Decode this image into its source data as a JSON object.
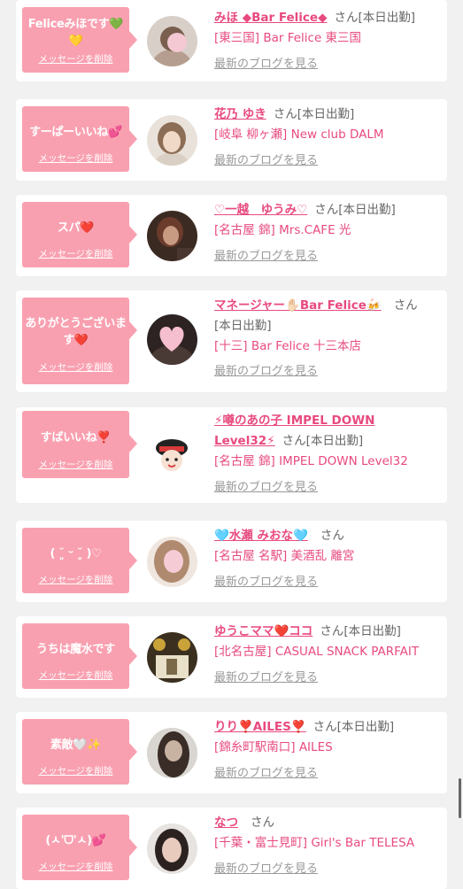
{
  "cards": [
    {
      "message": "Feliceみほです💚💛",
      "delete_label": "メッセージを削除",
      "name": "みほ ◆Bar Felice◆",
      "san": "さん",
      "shift": "[本日出勤]",
      "shop": "[東三国] Bar Felice 東三国",
      "blog": "最新のブログを見る",
      "avatar_colors": [
        "#d8cfc9",
        "#7a5f4e",
        "#f4c9d4"
      ]
    },
    {
      "message": "すーぱーいいね💕",
      "delete_label": "メッセージを削除",
      "name": "花乃 ゆき",
      "san": "さん",
      "shift": "[本日出勤]",
      "shop": "[岐阜 柳ヶ瀬] New club DALM",
      "blog": "最新のブログを見る",
      "avatar_colors": [
        "#e9e2da",
        "#8c6d55",
        "#f1d9c8"
      ]
    },
    {
      "message": "スパ❤️",
      "delete_label": "メッセージを削除",
      "name": "♡一越　ゆうみ♡",
      "san": "さん",
      "shift": "[本日出勤]",
      "shop": "[名古屋 錦] Mrs.CAFE 光",
      "blog": "最新のブログを見る",
      "avatar_colors": [
        "#3a2a22",
        "#6b3b2c",
        "#c79a82"
      ]
    },
    {
      "message": "ありがとうございます❤️",
      "delete_label": "メッセージを削除",
      "name": "マネージャー✋🏻Bar Felice🍻",
      "san": "さん",
      "shift": "[本日出勤]",
      "shop": "[十三] Bar Felice 十三本店",
      "blog": "最新のブログを見る",
      "avatar_colors": [
        "#2c2322",
        "#4a3a36",
        "#f6bfd0"
      ]
    },
    {
      "message": "すばいいね❣️",
      "delete_label": "メッセージを削除",
      "name": "⚡噂のあの子 IMPEL DOWN Level32⚡",
      "san": "さん",
      "shift": "[本日出勤]",
      "shop": "[名古屋 錦] IMPEL DOWN Level32",
      "blog": "最新のブログを見る",
      "avatar_colors": [
        "#ffffff",
        "#222222",
        "#d63a3a"
      ]
    },
    {
      "message": "( ˘͈ ᵕ ˘͈ )♡",
      "delete_label": "メッセージを削除",
      "name": "🩵水瀬 みおな🩵",
      "san": "さん",
      "shift": "",
      "shop": "[名古屋 名駅] 美酒乱 離宮",
      "blog": "最新のブログを見る",
      "avatar_colors": [
        "#efe6df",
        "#b08a6e",
        "#f5cbd6"
      ]
    },
    {
      "message": "うちは魔水です",
      "delete_label": "メッセージを削除",
      "name": "ゆうこママ❤️ココ",
      "san": "さん",
      "shift": "[本日出勤]",
      "shop": "[北名古屋] CASUAL SNACK PARFAIT",
      "blog": "最新のブログを見る",
      "avatar_colors": [
        "#3b3020",
        "#c9a23a",
        "#e8e0c8"
      ]
    },
    {
      "message": "素敵🤍✨",
      "delete_label": "メッセージを削除",
      "name": "りり❣️AILES❣️",
      "san": "さん",
      "shift": "[本日出勤]",
      "shop": "[錦糸町駅南口] AILES",
      "blog": "最新のブログを見る",
      "avatar_colors": [
        "#d9d6d2",
        "#3a2c26",
        "#c8b2a2"
      ]
    },
    {
      "message": "(ㅅ'ᗜ'ㅅ)💕",
      "delete_label": "メッセージを削除",
      "name": "なつ",
      "san": "さん",
      "shift": "",
      "shop": "[千葉・富士見町] Girl's Bar TELESA",
      "blog": "最新のブログを見る",
      "avatar_colors": [
        "#e7e3e0",
        "#2b2220",
        "#e8cbbd"
      ]
    }
  ]
}
